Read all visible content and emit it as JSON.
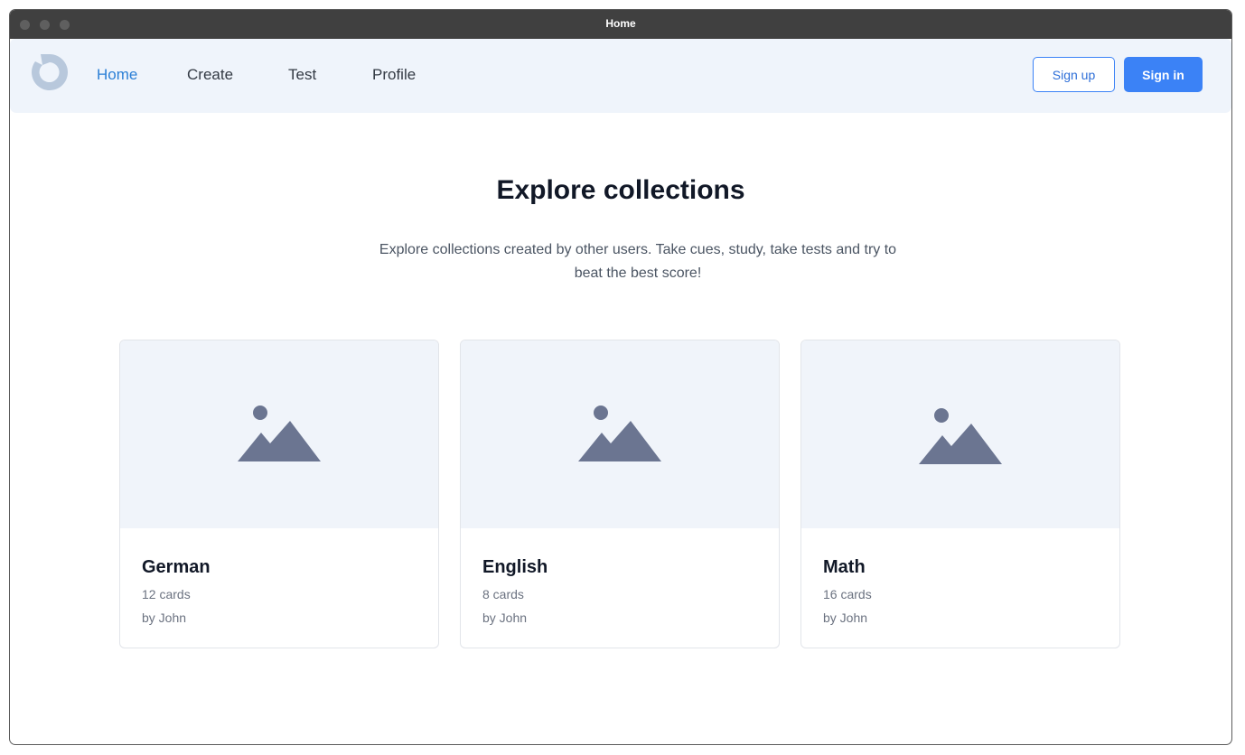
{
  "window": {
    "title": "Home"
  },
  "navbar": {
    "links": [
      {
        "label": "Home",
        "active": true
      },
      {
        "label": "Create",
        "active": false
      },
      {
        "label": "Test",
        "active": false
      },
      {
        "label": "Profile",
        "active": false
      }
    ],
    "signup_label": "Sign up",
    "signin_label": "Sign in"
  },
  "hero": {
    "title": "Explore collections",
    "subtitle": "Explore collections created by other users. Take cues, study, take tests and try to beat the best score!"
  },
  "collections": [
    {
      "title": "German",
      "count": "12 cards",
      "author": "by John",
      "image_icon": "image-placeholder-icon"
    },
    {
      "title": "English",
      "count": "8 cards",
      "author": "by John",
      "image_icon": "image-placeholder-icon"
    },
    {
      "title": "Math",
      "count": "16 cards",
      "author": "by John",
      "image_icon": "image-placeholder-icon"
    }
  ],
  "colors": {
    "accent": "#3b82f6",
    "active_link": "#2b7fd6",
    "navbar_bg": "#eff4fb",
    "placeholder_icon": "#6b7280",
    "logo": "#b8c8dc"
  }
}
